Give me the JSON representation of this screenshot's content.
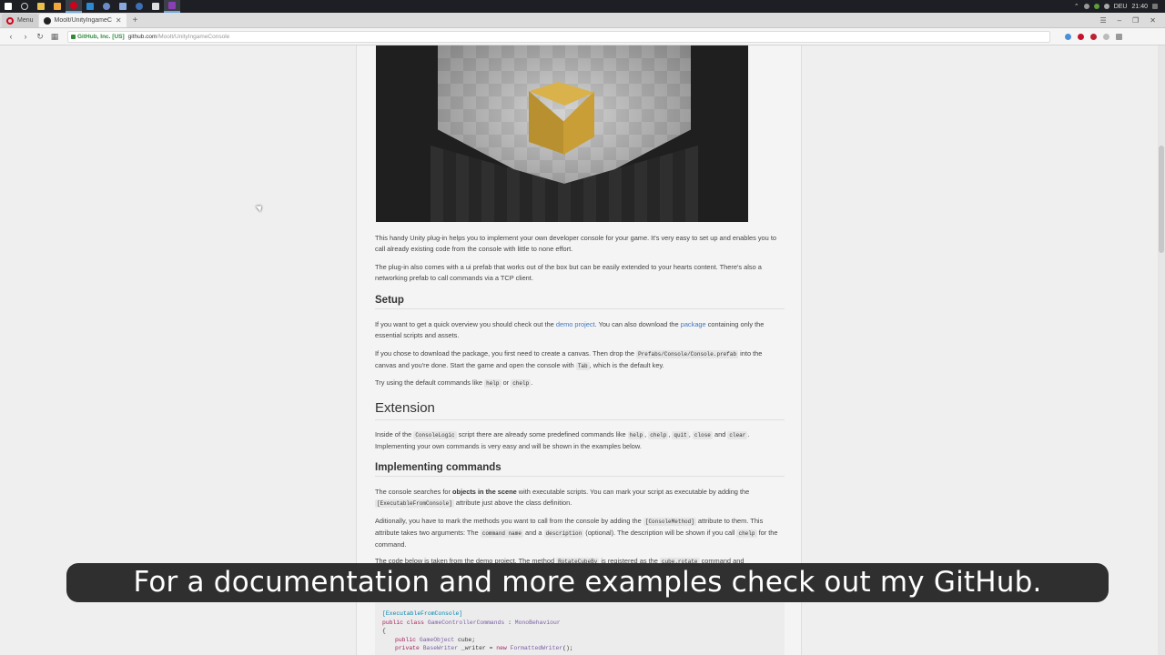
{
  "taskbar": {
    "tray_lang": "DEU",
    "tray_time": "21:40"
  },
  "tabs": [
    {
      "label": "Menu"
    },
    {
      "label": "Moolt/UnityIngameConsole"
    }
  ],
  "address": {
    "secure_label": "GitHub, Inc. [US]",
    "host": "github.com",
    "path": "/Moolt/UnityIngameConsole"
  },
  "article": {
    "intro1": "This handy Unity plug-in helps you to implement your own developer console for your game. It's very easy to set up and enables you to call already existing code from the console with little to none effort.",
    "intro2": "The plug-in also comes with a ui prefab that works out of the box but can be easily extended to your hearts content. There's also a networking prefab to call commands via a TCP client.",
    "setup_heading": "Setup",
    "setup_p1_a": "If you want to get a quick overview you should check out the",
    "setup_p1_link1": "demo project",
    "setup_p1_b": ". You can also download the",
    "setup_p1_link2": "package",
    "setup_p1_c": "containing only the essential scripts and assets.",
    "setup_p2_a": "If you chose to download the package, you first need to create a canvas. Then drop the",
    "setup_p2_code1": "Prefabs/Console/Console.prefab",
    "setup_p2_b": "into the canvas and you're done. Start the game and open the console with",
    "setup_p2_code2": "Tab",
    "setup_p2_c": ", which is the default key.",
    "setup_p3_a": "Try using the default commands like",
    "setup_p3_code1": "help",
    "setup_p3_b": "or",
    "setup_p3_code2": "chelp",
    "setup_p3_c": ".",
    "extension_heading": "Extension",
    "ext_p1_a": "Inside of the",
    "ext_p1_code1": "ConsoleLogic",
    "ext_p1_b": "script there are already some predefined commands like",
    "ext_p1_code2": "help",
    "ext_p1_code3": "chelp",
    "ext_p1_code4": "quit",
    "ext_p1_code5": "close",
    "ext_p1_and": "and",
    "ext_p1_code6": "clear",
    "ext_p1_c": ". Implementing your own commands is very easy and will be shown in the examples below.",
    "impl_heading": "Implementing commands",
    "impl_p1_a": "The console searches for",
    "impl_p1_bold": "objects in the scene",
    "impl_p1_b": "with executable scripts. You can mark your script as executable by adding the",
    "impl_p1_code": "[ExecutableFromConsole]",
    "impl_p1_c": "attribute just above the class definition.",
    "impl_p2_a": "Aditionally, you have to mark the methods you want to call from the console by adding the",
    "impl_p2_code1": "[ConsoleMethod]",
    "impl_p2_b": "attribute to them. This attribute takes two arguments: The",
    "impl_p2_code2": "command name",
    "impl_p2_c": "and a",
    "impl_p2_code3": "description",
    "impl_p2_d": "(optional). The description will be shown if you call",
    "impl_p2_code4": "chelp",
    "impl_p2_e": "for the command.",
    "impl_p3_a": "The code below is taken from the demo project. The method",
    "impl_p3_code1": "RotateCubeBy",
    "impl_p3_b": "is registered as the",
    "impl_p3_code2": "cube.rotate",
    "impl_p3_c": "command and"
  },
  "code": {
    "line1": "[ExecutableFromConsole]",
    "line2_kw": "public class",
    "line2_name": "GameControllerCommands",
    "line2_sep": " : ",
    "line2_base": "MonoBehaviour",
    "line3": "{",
    "line4_kw": "public",
    "line4_type": "GameObject",
    "line4_rest": " cube;",
    "line5_kw": "private",
    "line5_type": "BaseWriter",
    "line5_mid": " _writer = ",
    "line5_new": "new",
    "line5_ctor": "FormattedWriter",
    "line5_end": "();"
  },
  "caption": "For a documentation and more examples check out my GitHub.",
  "icons": [
    "windows-start-icon",
    "search-icon",
    "folder-icon",
    "opera-icon",
    "github-icon",
    "lock-icon",
    "back-icon",
    "forward-icon",
    "reload-icon",
    "grid-icon"
  ]
}
